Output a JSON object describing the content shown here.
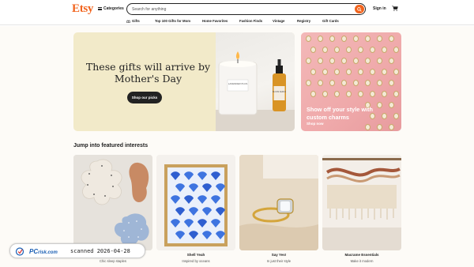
{
  "header": {
    "logo": "Etsy",
    "categories_label": "Categories",
    "search_placeholder": "Search for anything",
    "signin_label": "Sign in"
  },
  "nav": {
    "items": [
      "Gifts",
      "Top 100 Gifts for Mom",
      "Home Favorites",
      "Fashion Finds",
      "Vintage",
      "Registry",
      "Gift Cards"
    ]
  },
  "hero": {
    "title": "These gifts will arrive by Mother's Day",
    "button": "Shop our picks",
    "candle_label": "LAVENDER PLUS",
    "bottle_label": "BLOOM SERUM"
  },
  "side_promo": {
    "text": "Show off your style with custom charms",
    "link": "Shop now"
  },
  "featured": {
    "title": "Jump into featured interests",
    "cards": [
      {
        "title": "Stay in bed",
        "subtitle": "Chic sleep staples"
      },
      {
        "title": "Shell Yeah",
        "subtitle": "Inspired by oceans"
      },
      {
        "title": "Say Yes!",
        "subtitle": "In just their style"
      },
      {
        "title": "Macrame Essentials",
        "subtitle": "Make it modern"
      }
    ]
  },
  "watermark": {
    "brand": "PC",
    "brand_suffix": "risk.com",
    "scan_text": "scanned 2026-04-28"
  },
  "colors": {
    "accent": "#f1641e",
    "hero_bg": "#f2eac9",
    "promo_bg": "#efa9aa"
  }
}
